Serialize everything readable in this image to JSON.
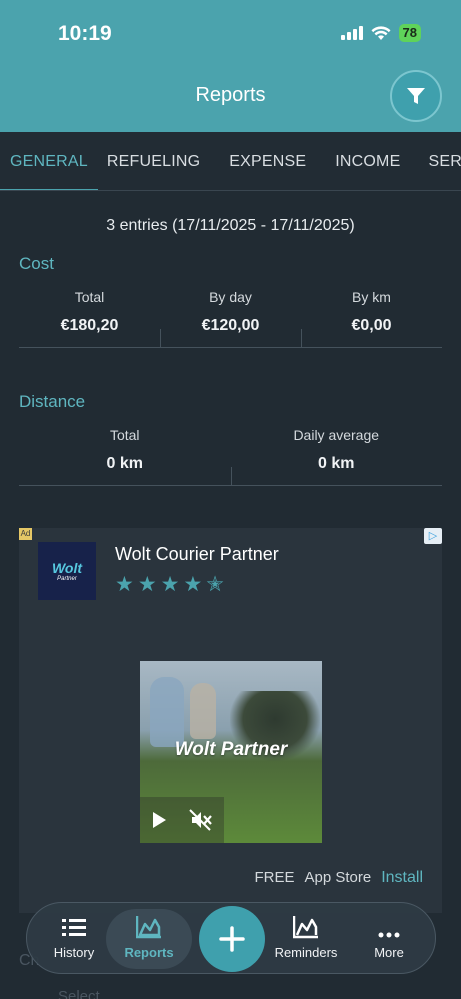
{
  "status_bar": {
    "time": "10:19",
    "battery": "78"
  },
  "header": {
    "title": "Reports"
  },
  "tabs": [
    "GENERAL",
    "REFUELING",
    "EXPENSE",
    "INCOME",
    "SERVIC"
  ],
  "entries_summary": "3 entries (17/11/2025 - 17/11/2025)",
  "cost": {
    "title": "Cost",
    "items": [
      {
        "label": "Total",
        "value": "€180,20"
      },
      {
        "label": "By day",
        "value": "€120,00"
      },
      {
        "label": "By km",
        "value": "€0,00"
      }
    ]
  },
  "distance": {
    "title": "Distance",
    "items": [
      {
        "label": "Total",
        "value": "0 km"
      },
      {
        "label": "Daily average",
        "value": "0 km"
      }
    ]
  },
  "ad": {
    "badge": "Ad",
    "logo_word": "Wolt",
    "logo_sub": "Partner",
    "title": "Wolt Courier Partner",
    "rating": 4.5,
    "stars": "★★★★✭",
    "media_brand": "Wolt Partner",
    "price": "FREE",
    "store": "App Store",
    "install": "Install"
  },
  "peek": {
    "section": "Ch",
    "select": "Select"
  },
  "bottom_nav": [
    {
      "label": "History",
      "icon": "list-icon"
    },
    {
      "label": "Reports",
      "icon": "chart-icon"
    },
    {
      "label": "",
      "icon": "plus-icon"
    },
    {
      "label": "Reminders",
      "icon": "chart-line-icon"
    },
    {
      "label": "More",
      "icon": "more-dots-icon"
    }
  ],
  "colors": {
    "accent": "#4ba3ad",
    "background": "#212b33",
    "active_text": "#5fb6c0"
  }
}
